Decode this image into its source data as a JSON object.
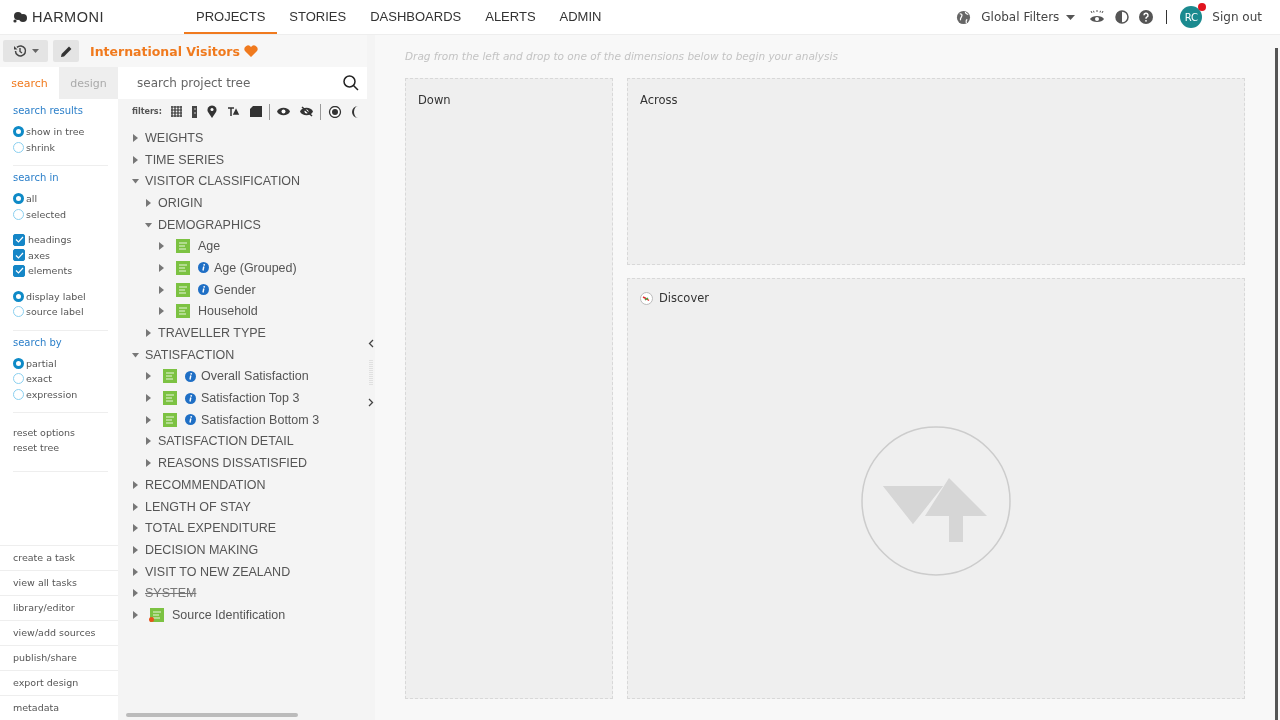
{
  "header": {
    "logo": "HARMONI",
    "nav": [
      {
        "label": "PROJECTS",
        "selected": true
      },
      {
        "label": "STORIES",
        "selected": false
      },
      {
        "label": "DASHBOARDS",
        "selected": false
      },
      {
        "label": "ALERTS",
        "selected": false
      },
      {
        "label": "ADMIN",
        "selected": false
      }
    ],
    "global_filters": "Global Filters",
    "avatar": "RC",
    "avatar_badge": true,
    "sign_out": "Sign out"
  },
  "toolbar": {
    "title": "International Visitors",
    "favorite": true
  },
  "options": {
    "tabs": [
      {
        "label": "search",
        "selected": true
      },
      {
        "label": "design",
        "selected": false
      }
    ],
    "sections": [
      {
        "heading": "search results",
        "groups": [
          [
            {
              "kind": "radio",
              "label": "show in tree",
              "selected": true
            },
            {
              "kind": "radio",
              "label": "shrink",
              "selected": false
            }
          ]
        ]
      },
      {
        "heading": "search in",
        "groups": [
          [
            {
              "kind": "radio",
              "label": "all",
              "selected": true
            },
            {
              "kind": "radio",
              "label": "selected",
              "selected": false
            }
          ],
          [
            {
              "kind": "checkbox",
              "label": "headings",
              "checked": true
            },
            {
              "kind": "checkbox",
              "label": "axes",
              "checked": true
            },
            {
              "kind": "checkbox",
              "label": "elements",
              "checked": true
            }
          ],
          [
            {
              "kind": "radio",
              "label": "display label",
              "selected": true
            },
            {
              "kind": "radio",
              "label": "source label",
              "selected": false
            }
          ]
        ]
      },
      {
        "heading": "search by",
        "groups": [
          [
            {
              "kind": "radio",
              "label": "partial",
              "selected": true
            },
            {
              "kind": "radio",
              "label": "exact",
              "selected": false
            },
            {
              "kind": "radio",
              "label": "expression",
              "selected": false
            }
          ]
        ]
      },
      {
        "groups": [
          [
            {
              "kind": "link",
              "label": "reset options"
            },
            {
              "kind": "link",
              "label": "reset tree"
            }
          ]
        ]
      }
    ],
    "actions": [
      "create a task",
      "view all tasks",
      "library/editor",
      "view/add sources",
      "publish/share",
      "export design",
      "metadata"
    ]
  },
  "search": {
    "placeholder": "search project tree"
  },
  "filters_label": "filters:",
  "tree": [
    {
      "label": "WEIGHTS",
      "kind": "heading",
      "expanded": false
    },
    {
      "label": "TIME SERIES",
      "kind": "heading",
      "expanded": false
    },
    {
      "label": "VISITOR CLASSIFICATION",
      "kind": "heading",
      "expanded": true,
      "children": [
        {
          "label": "ORIGIN",
          "kind": "heading",
          "expanded": false
        },
        {
          "label": "DEMOGRAPHICS",
          "kind": "heading",
          "expanded": true,
          "children": [
            {
              "label": "Age",
              "kind": "variable",
              "info": false,
              "expanded": false
            },
            {
              "label": "Age (Grouped)",
              "kind": "variable",
              "info": true,
              "expanded": false
            },
            {
              "label": "Gender",
              "kind": "variable",
              "info": true,
              "expanded": false
            },
            {
              "label": "Household",
              "kind": "variable",
              "info": false,
              "expanded": false
            }
          ]
        },
        {
          "label": "TRAVELLER TYPE",
          "kind": "heading",
          "expanded": false
        }
      ]
    },
    {
      "label": "SATISFACTION",
      "kind": "heading",
      "expanded": true,
      "children": [
        {
          "label": "Overall Satisfaction",
          "kind": "variable",
          "info": true,
          "expanded": false
        },
        {
          "label": "Satisfaction Top 3",
          "kind": "variable",
          "info": true,
          "expanded": false
        },
        {
          "label": "Satisfaction Bottom 3",
          "kind": "variable",
          "info": true,
          "expanded": false
        },
        {
          "label": "SATISFACTION DETAIL",
          "kind": "heading",
          "expanded": false
        },
        {
          "label": "REASONS DISSATISFIED",
          "kind": "heading",
          "expanded": false
        }
      ]
    },
    {
      "label": "RECOMMENDATION",
      "kind": "heading",
      "expanded": false
    },
    {
      "label": "LENGTH OF STAY",
      "kind": "heading",
      "expanded": false
    },
    {
      "label": "TOTAL EXPENDITURE",
      "kind": "heading",
      "expanded": false
    },
    {
      "label": "DECISION MAKING",
      "kind": "heading",
      "expanded": false
    },
    {
      "label": "VISIT TO NEW ZEALAND",
      "kind": "heading",
      "expanded": false
    },
    {
      "label": "SYSTEM",
      "kind": "heading",
      "disabled": true,
      "expanded": false
    },
    {
      "label": "Source Identification",
      "kind": "source",
      "expanded": false
    }
  ],
  "main": {
    "hint": "Drag from the left and drop to one of the dimensions below to begin your analysis",
    "down": "Down",
    "across": "Across",
    "discover": "Discover"
  }
}
